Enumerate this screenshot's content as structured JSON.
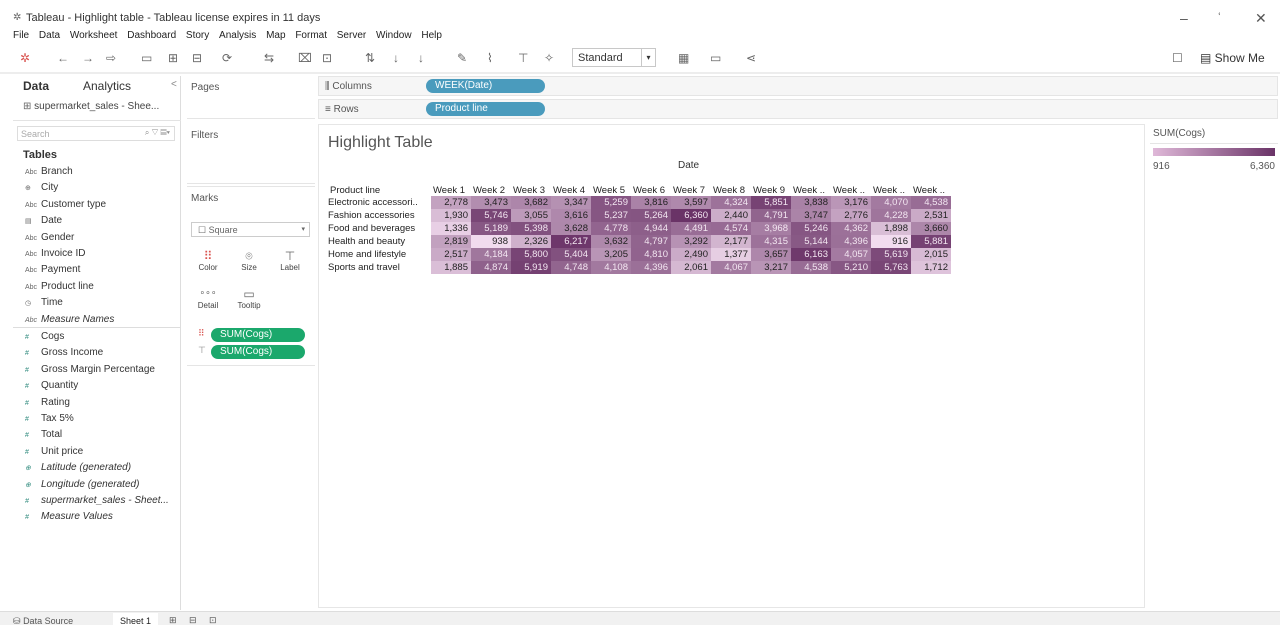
{
  "window": {
    "title": "Tableau - Highlight table - Tableau license expires in 11 days",
    "minimize": "–",
    "maximize": "ʿ",
    "close": "✕"
  },
  "menu": [
    "File",
    "Data",
    "Worksheet",
    "Dashboard",
    "Story",
    "Analysis",
    "Map",
    "Format",
    "Server",
    "Window",
    "Help"
  ],
  "toolbar": {
    "fit_select": "Standard",
    "show_me": "Show Me",
    "icons": [
      "tableau-logo-icon",
      "back-icon",
      "forward-icon",
      "new-datasource-icon",
      "save-icon",
      "new-sheet-icon",
      "duplicate-icon",
      "refresh-icon",
      "swap-icon",
      "sort-asc-icon",
      "sort-desc-icon",
      "highlight-icon",
      "group-icon",
      "labels-icon",
      "pin-icon",
      "presentation-icon",
      "share-icon"
    ]
  },
  "left": {
    "tab_data": "Data",
    "tab_analytics": "Analytics",
    "collapse": "<",
    "datasource": "supermarket_sales - Shee...",
    "search_placeholder": "Search",
    "tables_header": "Tables",
    "dimensions": [
      {
        "icon": "Abc",
        "name": "Branch"
      },
      {
        "icon": "⊕",
        "name": "City"
      },
      {
        "icon": "Abc",
        "name": "Customer type"
      },
      {
        "icon": "▤",
        "name": "Date"
      },
      {
        "icon": "Abc",
        "name": "Gender"
      },
      {
        "icon": "Abc",
        "name": "Invoice ID"
      },
      {
        "icon": "Abc",
        "name": "Payment"
      },
      {
        "icon": "Abc",
        "name": "Product line"
      },
      {
        "icon": "◷",
        "name": "Time"
      },
      {
        "icon": "Abc",
        "name": "Measure Names"
      }
    ],
    "measures": [
      {
        "icon": "#",
        "name": "Cogs"
      },
      {
        "icon": "#",
        "name": "Gross Income"
      },
      {
        "icon": "#",
        "name": "Gross Margin Percentage"
      },
      {
        "icon": "#",
        "name": "Quantity"
      },
      {
        "icon": "#",
        "name": "Rating"
      },
      {
        "icon": "#",
        "name": "Tax 5%"
      },
      {
        "icon": "#",
        "name": "Total"
      },
      {
        "icon": "#",
        "name": "Unit price"
      },
      {
        "icon": "⊕",
        "name": "Latitude (generated)"
      },
      {
        "icon": "⊕",
        "name": "Longitude (generated)"
      },
      {
        "icon": "#",
        "name": "supermarket_sales - Sheet..."
      },
      {
        "icon": "#",
        "name": "Measure Values"
      }
    ]
  },
  "cards": {
    "pages": "Pages",
    "filters": "Filters",
    "marks": "Marks",
    "mark_type": "Square",
    "buttons": [
      "Color",
      "Size",
      "Label",
      "Detail",
      "Tooltip"
    ],
    "pills": [
      "SUM(Cogs)",
      "SUM(Cogs)"
    ]
  },
  "shelves": {
    "columns_label": "Columns",
    "columns_pill": "WEEK(Date)",
    "rows_label": "Rows",
    "rows_pill": "Product line"
  },
  "view": {
    "title": "Highlight Table",
    "date_header": "Date"
  },
  "legend": {
    "title": "SUM(Cogs)",
    "min_label": "916",
    "max_label": "6,360",
    "color_min": "#f2dcef",
    "color_max": "#6a3367"
  },
  "chart_data": {
    "type": "heatmap",
    "row_header": "Product line",
    "columns": [
      "Week 1",
      "Week 2",
      "Week 3",
      "Week 4",
      "Week 5",
      "Week 6",
      "Week 7",
      "Week 8",
      "Week 9",
      "Week ..",
      "Week ..",
      "Week ..",
      "Week .."
    ],
    "rows": [
      {
        "name": "Electronic accessori..",
        "values": [
          2778,
          3473,
          3682,
          3347,
          5259,
          3816,
          3597,
          4324,
          5851,
          3838,
          3176,
          4070,
          4538
        ]
      },
      {
        "name": "Fashion accessories",
        "values": [
          1930,
          5746,
          3055,
          3616,
          5237,
          5264,
          6360,
          2440,
          4791,
          3747,
          2776,
          4228,
          2531
        ]
      },
      {
        "name": "Food and beverages",
        "values": [
          1336,
          5189,
          5398,
          3628,
          4778,
          4944,
          4491,
          4574,
          3968,
          5246,
          4362,
          1898,
          3660
        ]
      },
      {
        "name": "Health and beauty",
        "values": [
          2819,
          938,
          2326,
          6217,
          3632,
          4797,
          3292,
          2177,
          4315,
          5144,
          4396,
          916,
          5881
        ]
      },
      {
        "name": "Home and lifestyle",
        "values": [
          2517,
          4184,
          5800,
          5404,
          3205,
          4810,
          2490,
          1377,
          3657,
          6163,
          4057,
          5619,
          2015
        ]
      },
      {
        "name": "Sports and travel",
        "values": [
          1885,
          4874,
          5919,
          4748,
          4108,
          4396,
          2061,
          4067,
          3217,
          4538,
          5210,
          5763,
          1712
        ]
      }
    ],
    "min": 916,
    "max": 6360
  },
  "status": {
    "datasource_tab": "Data Source",
    "sheet_tab": "Sheet 1"
  }
}
